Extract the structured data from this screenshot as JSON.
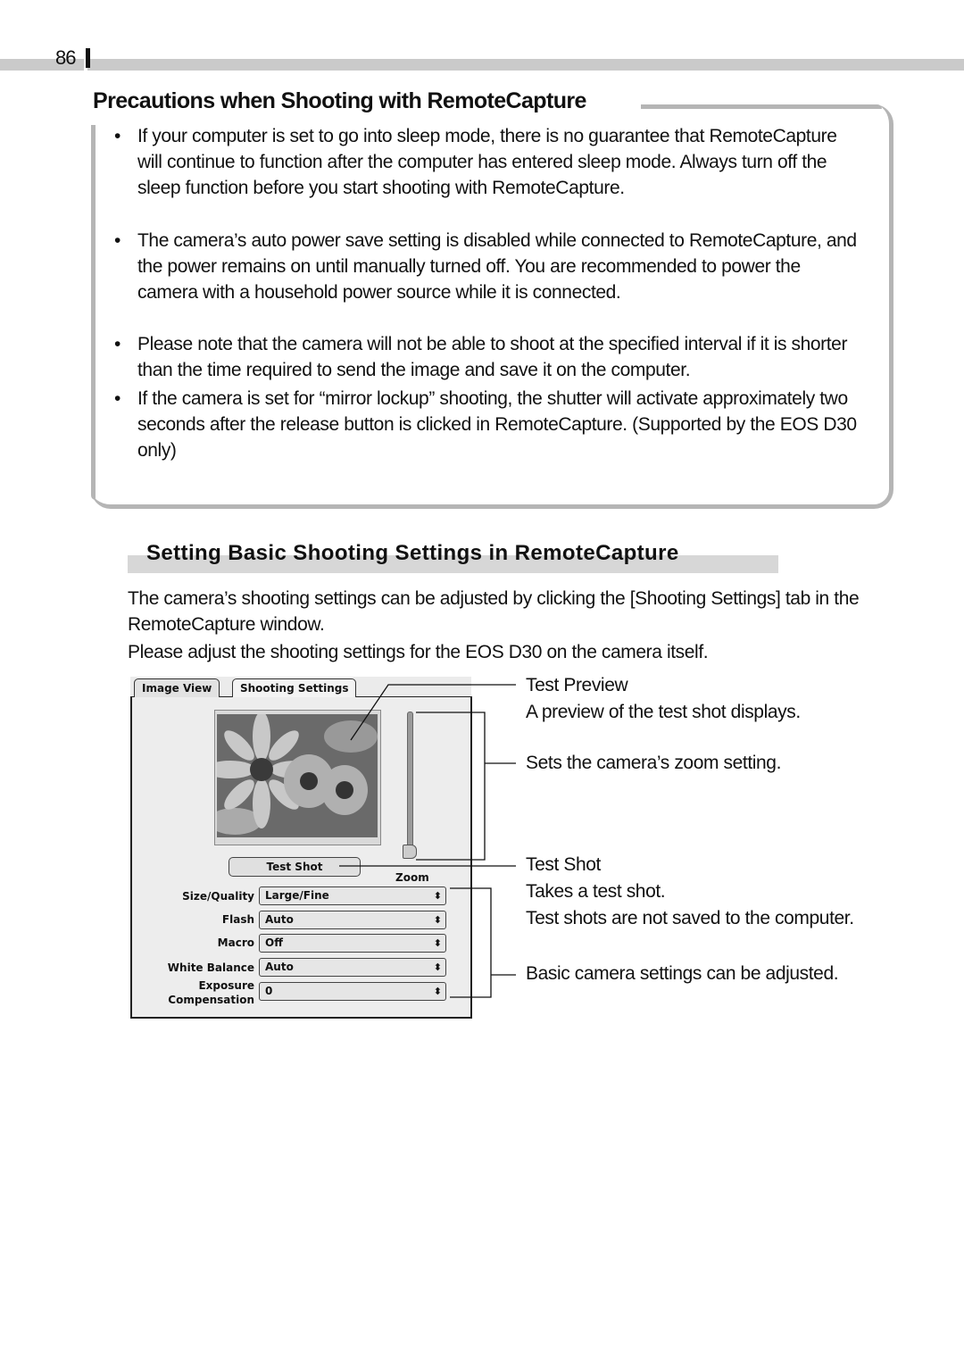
{
  "page": {
    "number": "86"
  },
  "precautions": {
    "title": "Precautions when Shooting with RemoteCapture",
    "items": [
      "If your computer is set to go into sleep mode, there is no guarantee that RemoteCapture will continue to function after the computer has entered sleep mode. Always turn off the sleep function before you start shooting with RemoteCapture.",
      "The camera’s auto power save setting is disabled while connected to RemoteCapture, and the power remains on until manually turned off. You are recommended to power the camera with a household power source while it is connected.",
      "Please note that the camera will not be able to shoot at the specified interval if it is shorter than the time required to send the image and save it on the computer.",
      "If the camera is set for “mirror lockup” shooting, the shutter will activate approximately two seconds after the release button is clicked in RemoteCapture. (Supported by the EOS D30 only)"
    ],
    "bullet": "•"
  },
  "section": {
    "title": "Setting Basic Shooting Settings in RemoteCapture",
    "para1": "The camera’s shooting settings can be adjusted by clicking the [Shooting Settings] tab in the RemoteCapture window.",
    "para2": "Please adjust the shooting settings for the EOS D30 on the camera itself."
  },
  "window": {
    "tabs": [
      {
        "label": "Image View",
        "active": false
      },
      {
        "label": "Shooting Settings",
        "active": true
      }
    ],
    "test_shot_button": "Test Shot",
    "zoom_label": "Zoom",
    "fields": [
      {
        "label": "Size/Quality",
        "value": "Large/Fine"
      },
      {
        "label": "Flash",
        "value": "Auto"
      },
      {
        "label": "Macro",
        "value": "Off"
      },
      {
        "label": "White Balance",
        "value": "Auto"
      },
      {
        "label": "Exposure Compensation",
        "label_line1": "Exposure",
        "label_line2": "Compensation",
        "value": "0"
      }
    ],
    "select_arrow": "⬍"
  },
  "callouts": {
    "test_preview_title": "Test Preview",
    "test_preview_desc": "A preview of the test shot displays.",
    "zoom_desc": "Sets the camera’s zoom setting.",
    "test_shot_title": "Test Shot",
    "test_shot_desc1": "Takes a test shot.",
    "test_shot_desc2": "Test shots are not saved to the computer.",
    "settings_desc": "Basic camera settings can be adjusted."
  }
}
